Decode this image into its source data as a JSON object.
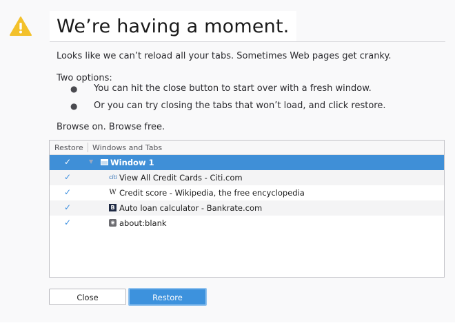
{
  "page": {
    "title": "We’re having a moment.",
    "intro": "Looks like we can’t reload all your tabs. Sometimes Web pages get cranky.",
    "options_heading": "Two options:",
    "options": [
      "You can hit the close button to start over with a fresh window.",
      "Or you can try closing the tabs that won’t load, and click restore."
    ],
    "outro": "Browse on. Browse free.",
    "warning_icon": "warning-triangle-icon"
  },
  "tree": {
    "columns": [
      "Restore",
      "Windows and Tabs"
    ],
    "window": {
      "label": "Window 1",
      "checked": true
    },
    "tabs": [
      {
        "label": "View All Credit Cards - Citi.com",
        "favicon": "citi-favicon",
        "checked": true
      },
      {
        "label": "Credit score - Wikipedia, the free encyclopedia",
        "favicon": "wikipedia-favicon",
        "checked": true
      },
      {
        "label": "Auto loan calculator - Bankrate.com",
        "favicon": "bankrate-favicon",
        "checked": true
      },
      {
        "label": "about:blank",
        "favicon": "blank-page-favicon",
        "checked": true
      }
    ]
  },
  "buttons": {
    "close": "Close",
    "restore": "Restore"
  },
  "colors": {
    "accent": "#3f8fd7",
    "warning": "#f3c12b",
    "check": "#3a8ee0"
  }
}
